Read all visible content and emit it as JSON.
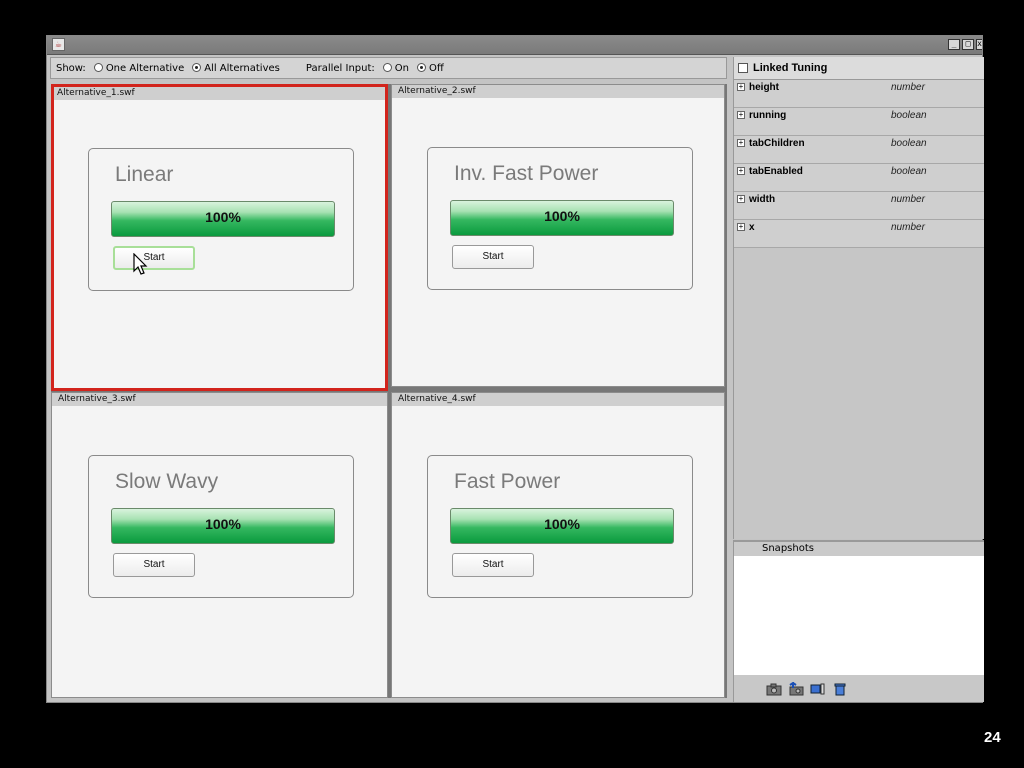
{
  "toolbar": {
    "show_label": "Show:",
    "show_options": [
      "One Alternative",
      "All Alternatives"
    ],
    "show_selected": "All Alternatives",
    "parallel_label": "Parallel Input:",
    "parallel_options": [
      "On",
      "Off"
    ],
    "parallel_selected": "Off"
  },
  "alternatives": [
    {
      "file": "Alternative_1.swf",
      "title": "Linear",
      "progress_text": "100%",
      "progress": 1.0,
      "button": "Start",
      "selected": true
    },
    {
      "file": "Alternative_2.swf",
      "title": "Inv. Fast Power",
      "progress_text": "100%",
      "progress": 1.0,
      "button": "Start",
      "selected": false
    },
    {
      "file": "Alternative_3.swf",
      "title": "Slow Wavy",
      "progress_text": "100%",
      "progress": 1.0,
      "button": "Start",
      "selected": false
    },
    {
      "file": "Alternative_4.swf",
      "title": "Fast Power",
      "progress_text": "100%",
      "progress": 1.0,
      "button": "Start",
      "selected": false
    }
  ],
  "panel": {
    "linked_tuning_label": "Linked Tuning",
    "linked_tuning_checked": false,
    "properties": [
      {
        "name": "height",
        "type": "number"
      },
      {
        "name": "running",
        "type": "boolean"
      },
      {
        "name": "tabChildren",
        "type": "boolean"
      },
      {
        "name": "tabEnabled",
        "type": "boolean"
      },
      {
        "name": "width",
        "type": "number"
      },
      {
        "name": "x",
        "type": "number"
      }
    ]
  },
  "snapshots": {
    "header": "Snapshots",
    "tools": [
      "camera-icon",
      "camera-upload-icon",
      "compare-icon",
      "trash-icon"
    ]
  },
  "slide": {
    "page_number": "24"
  }
}
